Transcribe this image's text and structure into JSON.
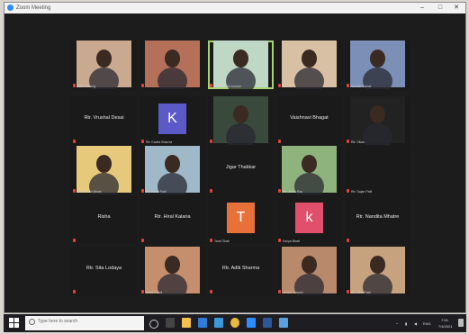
{
  "window": {
    "title": "Zoom Meeting",
    "minimize_glyph": "–",
    "maximize_glyph": "□",
    "close_glyph": "✕"
  },
  "participants": [
    {
      "display_name": "",
      "caption": "Ram Gurung",
      "kind": "video",
      "tint": "#c9a98f"
    },
    {
      "display_name": "",
      "caption": "",
      "kind": "video",
      "tint": "#b5705a"
    },
    {
      "display_name": "",
      "caption": "Ms Sunitha Joseph",
      "kind": "video",
      "tint": "#bfd8c6",
      "active": true
    },
    {
      "display_name": "",
      "caption": "",
      "kind": "video",
      "tint": "#d8c0a4"
    },
    {
      "display_name": "",
      "caption": "Manish Kumar",
      "kind": "video",
      "tint": "#7c8fb7"
    },
    {
      "display_name": "Rtr. Vrushal Desai",
      "caption": "",
      "kind": "name"
    },
    {
      "display_name": "",
      "caption": "Rtr. Kavita Sharma",
      "kind": "initial",
      "letter": "K",
      "color": "#5c59c9"
    },
    {
      "display_name": "",
      "caption": "",
      "kind": "video",
      "tint": "#394a3c"
    },
    {
      "display_name": "Vaishnavi Bhagat",
      "caption": "",
      "kind": "name"
    },
    {
      "display_name": "",
      "caption": "Rtr. Vikas",
      "kind": "video",
      "tint": "#222222"
    },
    {
      "display_name": "",
      "caption": "Rtr. Yashvi Bhide",
      "kind": "video",
      "tint": "#e6c97a"
    },
    {
      "display_name": "",
      "caption": "Rtr. Neha Patil",
      "kind": "video",
      "tint": "#9fb9c8"
    },
    {
      "display_name": "Jigar Thakkar",
      "caption": "",
      "kind": "name"
    },
    {
      "display_name": "",
      "caption": "Rtr. Anish Rao",
      "kind": "video",
      "tint": "#8fb37d"
    },
    {
      "display_name": "",
      "caption": "Rtr. Sajan Patil",
      "kind": "name"
    },
    {
      "display_name": "Risha",
      "caption": "",
      "kind": "name"
    },
    {
      "display_name": "Rtr. Hiral Kalaria",
      "caption": "",
      "kind": "name"
    },
    {
      "display_name": "",
      "caption": "Tanvi Shah",
      "kind": "initial",
      "letter": "T",
      "color": "#e8713a"
    },
    {
      "display_name": "",
      "caption": "Kavya Bhatt",
      "kind": "initial",
      "letter": "k",
      "color": "#e0506c"
    },
    {
      "display_name": "Rtr. Nandita Mhatre",
      "caption": "",
      "kind": "name"
    },
    {
      "display_name": "Rtr. Sita Lodaya",
      "caption": "",
      "kind": "name"
    },
    {
      "display_name": "",
      "caption": "Neha Doshi",
      "kind": "video",
      "tint": "#c58e6c"
    },
    {
      "display_name": "Rtr. Aditi Sharma",
      "caption": "",
      "kind": "name"
    },
    {
      "display_name": "",
      "caption": "Jenish Solanki",
      "kind": "video",
      "tint": "#b9896b"
    },
    {
      "display_name": "",
      "caption": "Rtr. Bina Patel",
      "kind": "video",
      "tint": "#c7a27e"
    }
  ],
  "taskbar": {
    "search_placeholder": "Type here to search",
    "time": "7:54",
    "date": "7/4/2021",
    "lang": "ENG"
  }
}
